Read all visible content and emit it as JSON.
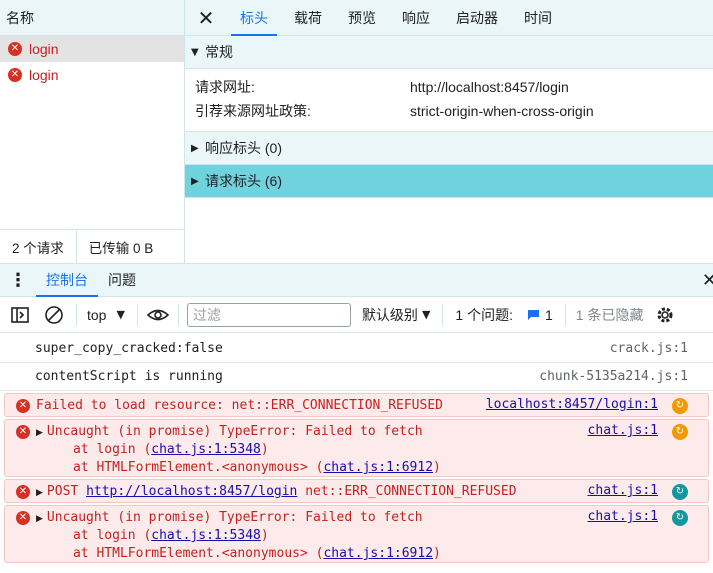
{
  "network": {
    "list_header": "名称",
    "requests": [
      {
        "name": "login",
        "status": "error"
      },
      {
        "name": "login",
        "status": "error"
      }
    ],
    "status_requests": "2 个请求",
    "status_transferred": "已传输 0 B"
  },
  "detail": {
    "close_glyph": "✕",
    "tabs": [
      "标头",
      "载荷",
      "预览",
      "响应",
      "启动器",
      "时间"
    ],
    "active_tab": "标头",
    "general": {
      "title": "常规",
      "rows": [
        {
          "key": "请求网址:",
          "value": "http://localhost:8457/login"
        },
        {
          "key": "引荐来源网址政策:",
          "value": "strict-origin-when-cross-origin"
        }
      ]
    },
    "response_headers": "响应标头 (0)",
    "request_headers": "请求标头 (6)"
  },
  "drawer": {
    "tabs": [
      "控制台",
      "问题"
    ],
    "active_tab": "控制台"
  },
  "toolbar": {
    "context": "top",
    "filter_placeholder": "过滤",
    "levels": "默认级别",
    "issues_label": "1 个问题:",
    "issues_count": "1",
    "hidden": "1 条已隐藏"
  },
  "console": {
    "messages": [
      {
        "text": "super_copy_cracked:false",
        "source": "crack.js:1"
      },
      {
        "text": "contentScript is running",
        "source": "chunk-5135a214.js:1"
      }
    ],
    "errors": [
      {
        "line1": "Failed to load resource: net::ERR_CONNECTION_REFUSED",
        "source": "localhost:8457/login:1"
      },
      {
        "line1": "Uncaught (in promise) TypeError: Failed to fetch",
        "at1_prefix": "at login (",
        "at1_link": "chat.js:1:5348",
        "at1_suffix": ")",
        "at2_prefix": "at HTMLFormElement.<anonymous> (",
        "at2_link": "chat.js:1:6912",
        "at2_suffix": ")",
        "source": "chat.js:1"
      },
      {
        "prefix": "POST ",
        "url": "http://localhost:8457/login",
        "suffix": " net::ERR_CONNECTION_REFUSED",
        "source": "chat.js:1"
      },
      {
        "line1": "Uncaught (in promise) TypeError: Failed to fetch",
        "at1_prefix": "at login (",
        "at1_link": "chat.js:1:5348",
        "at1_suffix": ")",
        "at2_prefix": "at HTMLFormElement.<anonymous> (",
        "at2_link": "chat.js:1:6912",
        "at2_suffix": ")",
        "source": "chat.js:1"
      }
    ]
  },
  "colors": {
    "accent": "#1a73e8",
    "error": "#c5221f",
    "selected_section": "#6fd2dd",
    "panel_bg": "#eaf6f8"
  },
  "icons": [
    "error-icon",
    "close-icon",
    "kebab-menu-icon",
    "sidebar-toggle-icon",
    "clear-console-icon",
    "eye-icon",
    "issue-message-icon",
    "settings-gear-icon",
    "source-refresh-icon"
  ]
}
